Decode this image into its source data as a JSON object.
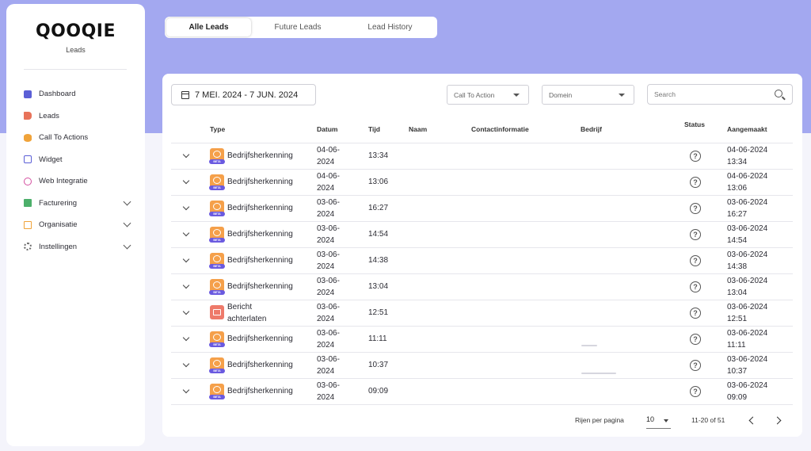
{
  "sidebar": {
    "logo": "QOOQIE",
    "subtitle": "Leads",
    "items": [
      {
        "label": "Dashboard",
        "icon": "grid-icon",
        "color": "#5b5fd6"
      },
      {
        "label": "Leads",
        "icon": "megaphone-icon",
        "color": "#e8735a"
      },
      {
        "label": "Call To Actions",
        "icon": "stack-icon",
        "color": "#f0a33a"
      },
      {
        "label": "Widget",
        "icon": "chat-icon",
        "color": "#5b5fd6"
      },
      {
        "label": "Web Integratie",
        "icon": "globe-icon",
        "color": "#d44fa0"
      },
      {
        "label": "Facturering",
        "icon": "invoice-icon",
        "color": "#4caf6a"
      },
      {
        "label": "Organisatie",
        "icon": "building-icon",
        "color": "#f0a33a"
      },
      {
        "label": "Instellingen",
        "icon": "gear-icon",
        "color": "#666666"
      }
    ]
  },
  "tabs": [
    "Alle Leads",
    "Future Leads",
    "Lead History"
  ],
  "filters": {
    "date_range": "7 MEI. 2024 - 7 JUN. 2024",
    "cta_placeholder": "Call To Action",
    "domain_placeholder": "Domein",
    "search_placeholder": "Search"
  },
  "table": {
    "headers": [
      "Type",
      "Datum",
      "Tijd",
      "Naam",
      "Contactinformatie",
      "Bedrijf",
      "Status",
      "Aangemaakt"
    ],
    "rows": [
      {
        "type": "Bedrijfsherkenning",
        "date": "04-06-2024",
        "time": "13:34",
        "created_date": "04-06-2024",
        "created_time": "13:34"
      },
      {
        "type": "Bedrijfsherkenning",
        "date": "04-06-2024",
        "time": "13:06",
        "created_date": "04-06-2024",
        "created_time": "13:06"
      },
      {
        "type": "Bedrijfsherkenning",
        "date": "03-06-2024",
        "time": "16:27",
        "created_date": "03-06-2024",
        "created_time": "16:27"
      },
      {
        "type": "Bedrijfsherkenning",
        "date": "03-06-2024",
        "time": "14:54",
        "created_date": "03-06-2024",
        "created_time": "14:54"
      },
      {
        "type": "Bedrijfsherkenning",
        "date": "03-06-2024",
        "time": "14:38",
        "created_date": "03-06-2024",
        "created_time": "14:38"
      },
      {
        "type": "Bedrijfsherkenning",
        "date": "03-06-2024",
        "time": "13:04",
        "created_date": "03-06-2024",
        "created_time": "13:04"
      },
      {
        "type": "Bericht achterlaten",
        "date": "03-06-2024",
        "time": "12:51",
        "created_date": "03-06-2024",
        "created_time": "12:51"
      },
      {
        "type": "Bedrijfsherkenning",
        "date": "03-06-2024",
        "time": "11:11",
        "created_date": "03-06-2024",
        "created_time": "11:11"
      },
      {
        "type": "Bedrijfsherkenning",
        "date": "03-06-2024",
        "time": "10:37",
        "created_date": "03-06-2024",
        "created_time": "10:37"
      },
      {
        "type": "Bedrijfsherkenning",
        "date": "03-06-2024",
        "time": "09:09",
        "created_date": "03-06-2024",
        "created_time": "09:09"
      }
    ],
    "beta_label": "BETA"
  },
  "pagination": {
    "rows_label": "Rijen per pagina",
    "rows_value": "10",
    "range": "11-20 of 51"
  }
}
